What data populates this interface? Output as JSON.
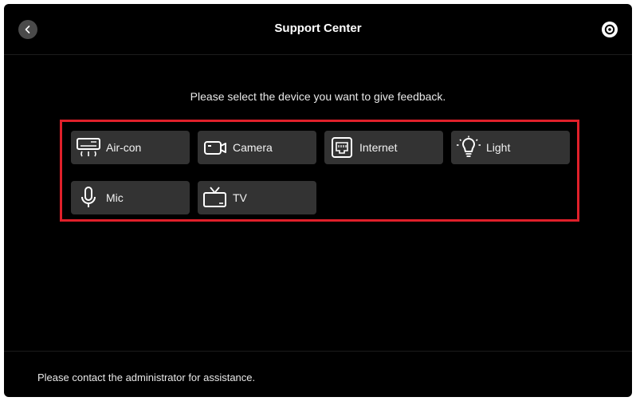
{
  "header": {
    "title": "Support Center",
    "back_icon": "chevron-left-icon",
    "settings_icon": "gear-icon"
  },
  "main": {
    "prompt": "Please select the device you want to give feedback.",
    "devices": [
      {
        "label": "Air-con",
        "icon": "air-conditioner-icon"
      },
      {
        "label": "Camera",
        "icon": "camera-icon"
      },
      {
        "label": "Internet",
        "icon": "network-port-icon"
      },
      {
        "label": "Light",
        "icon": "light-bulb-icon"
      },
      {
        "label": "Mic",
        "icon": "microphone-icon"
      },
      {
        "label": "TV",
        "icon": "tv-icon"
      }
    ]
  },
  "footer": {
    "text": "Please contact the administrator for assistance."
  },
  "colors": {
    "background": "#000000",
    "tile": "#333333",
    "highlight": "#e0202a",
    "text": "#ffffff"
  }
}
